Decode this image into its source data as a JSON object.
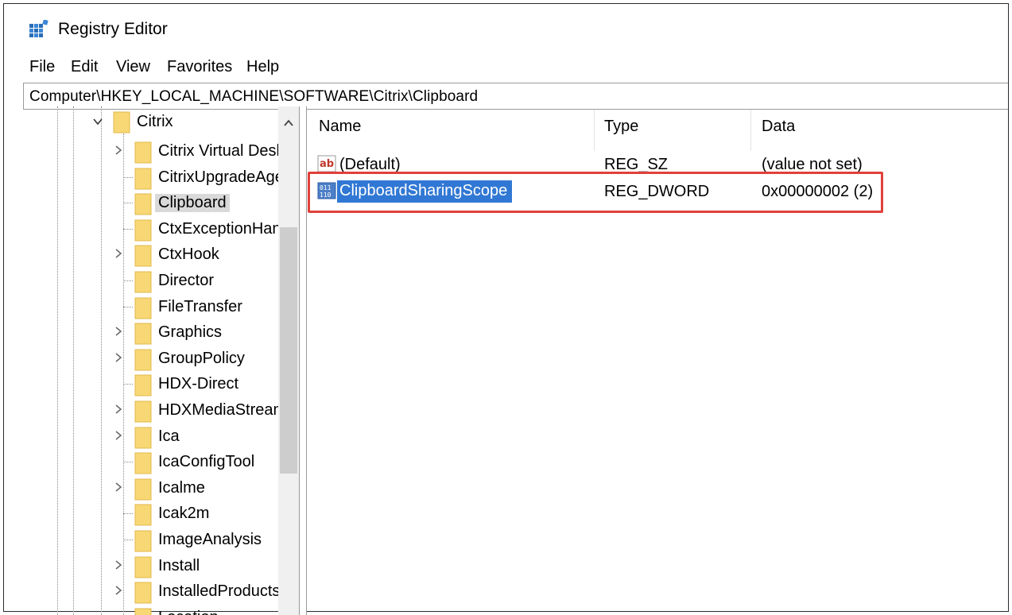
{
  "window": {
    "title": "Registry Editor",
    "app_icon": "registry-editor-icon"
  },
  "menu": [
    "File",
    "Edit",
    "View",
    "Favorites",
    "Help"
  ],
  "address": {
    "path": "Computer\\HKEY_LOCAL_MACHINE\\SOFTWARE\\Citrix\\Clipboard"
  },
  "tree": {
    "parent": {
      "label": "Citrix",
      "expanded": true
    },
    "children": [
      {
        "label": "Citrix Virtual Desk",
        "expandable": true
      },
      {
        "label": "CitrixUpgradeAge",
        "expandable": false
      },
      {
        "label": "Clipboard",
        "expandable": false,
        "selected": true
      },
      {
        "label": "CtxExceptionHan",
        "expandable": false
      },
      {
        "label": "CtxHook",
        "expandable": true
      },
      {
        "label": "Director",
        "expandable": false
      },
      {
        "label": "FileTransfer",
        "expandable": false
      },
      {
        "label": "Graphics",
        "expandable": true
      },
      {
        "label": "GroupPolicy",
        "expandable": true
      },
      {
        "label": "HDX-Direct",
        "expandable": false
      },
      {
        "label": "HDXMediaStream",
        "expandable": true
      },
      {
        "label": "Ica",
        "expandable": true
      },
      {
        "label": "IcaConfigTool",
        "expandable": false
      },
      {
        "label": "Icalme",
        "expandable": true
      },
      {
        "label": "Icak2m",
        "expandable": false
      },
      {
        "label": "ImageAnalysis",
        "expandable": false
      },
      {
        "label": "Install",
        "expandable": true
      },
      {
        "label": "InstalledProducts",
        "expandable": true
      },
      {
        "label": "Location",
        "expandable": false
      }
    ]
  },
  "list": {
    "columns": [
      "Name",
      "Type",
      "Data"
    ],
    "rows": [
      {
        "icon": "string-value-icon",
        "name": "(Default)",
        "type": "REG_SZ",
        "data": "(value not set)",
        "selected": false
      },
      {
        "icon": "binary-value-icon",
        "name": "ClipboardSharingScope",
        "type": "REG_DWORD",
        "data": "0x00000002 (2)",
        "selected": true
      }
    ]
  },
  "colors": {
    "selection": "#3178d4",
    "highlight_box": "#e0413a",
    "folder": "#f8d775"
  }
}
